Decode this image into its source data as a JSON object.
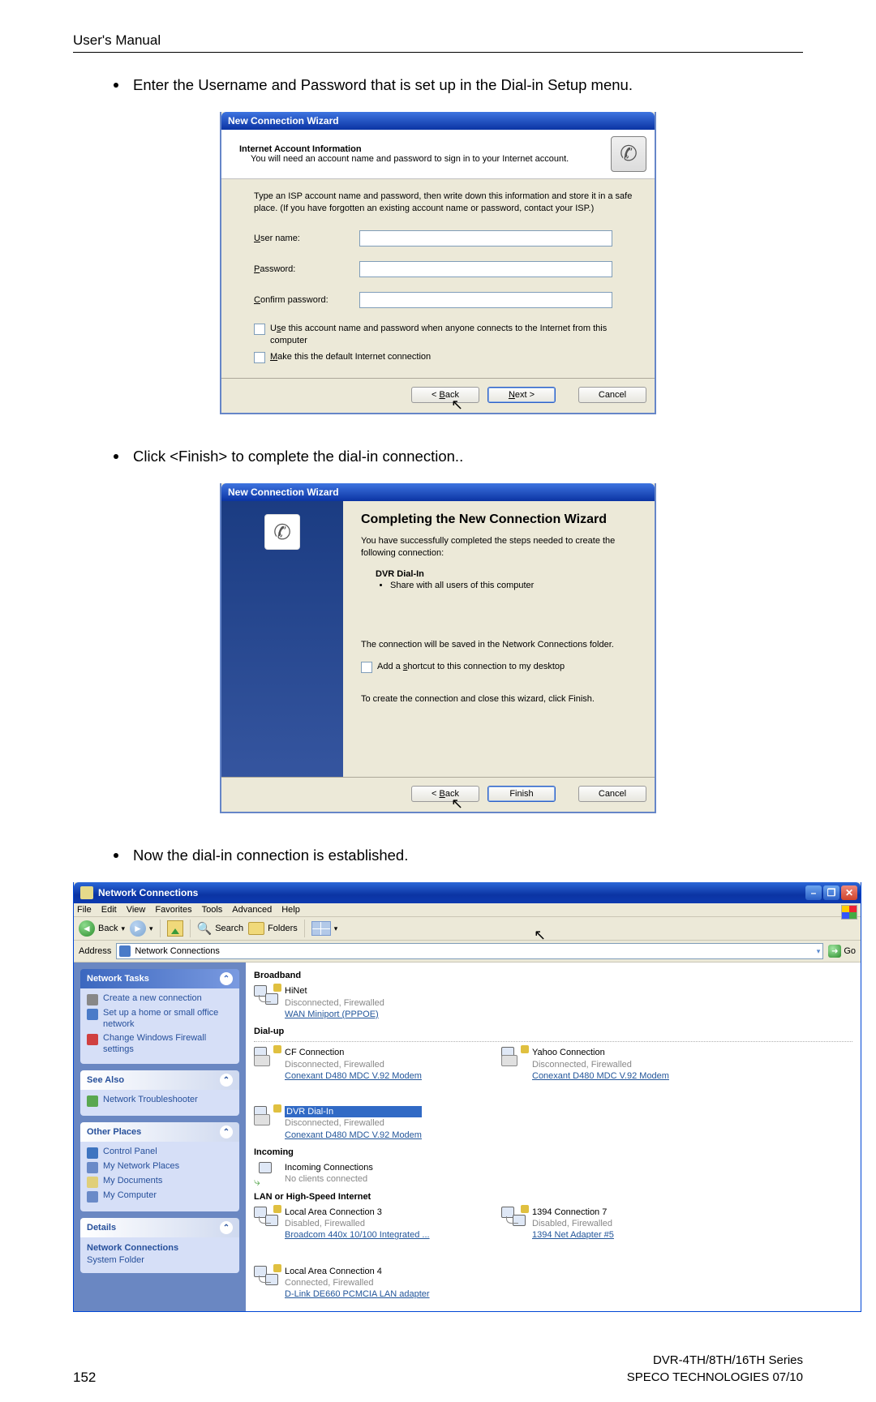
{
  "header": "User's Manual",
  "bullets": {
    "b1": "Enter the Username and Password that is set up in the Dial-in Setup menu.",
    "b2": "Click <Finish> to complete the dial-in connection..",
    "b3": "Now the dial-in connection is established."
  },
  "dlg1": {
    "title": "New Connection Wizard",
    "head_bold": "Internet Account Information",
    "head_sub": "You will need an account name and password to sign in to your Internet account.",
    "intro": "Type an ISP account name and password, then write down this information and store it in a safe place. (If you have forgotten an existing account name or password, contact your ISP.)",
    "lbl_user_pre": "U",
    "lbl_user_rest": "ser name:",
    "lbl_pass_pre": "P",
    "lbl_pass_rest": "assword:",
    "lbl_conf_pre": "C",
    "lbl_conf_rest": "onfirm password:",
    "cb1_pre": "U",
    "cb1_mid": "s",
    "cb1_rest": "e this account name and password when anyone connects to the Internet from this computer",
    "cb2_pre": "M",
    "cb2_rest": "ake this the default Internet connection",
    "back_pre": "< ",
    "back_u": "B",
    "back_rest": "ack",
    "next_u": "N",
    "next_rest": "ext >",
    "cancel": "Cancel"
  },
  "dlg2": {
    "title": "New Connection Wizard",
    "h": "Completing the New Connection Wizard",
    "suc": "You have successfully completed the steps needed to create the following connection:",
    "cname": "DVR Dial-In",
    "cshare": "Share with all users of this computer",
    "saved": "The connection will be saved in the Network Connections folder.",
    "cb_shortcut": "Add a shortcut to this connection to my desktop",
    "cb_shortcut_u": "s",
    "close": "To create the connection and close this wizard, click Finish.",
    "finish": "Finish"
  },
  "exp": {
    "title": "Network Connections",
    "menus": [
      "File",
      "Edit",
      "View",
      "Favorites",
      "Tools",
      "Advanced",
      "Help"
    ],
    "tb_back": "Back",
    "tb_search": "Search",
    "tb_folders": "Folders",
    "addr_label": "Address",
    "addr_value": "Network Connections",
    "go": "Go",
    "panel_tasks": "Network Tasks",
    "tasks": [
      "Create a new connection",
      "Set up a home or small office network",
      "Change Windows Firewall settings"
    ],
    "panel_see_also": "See Also",
    "see_also": [
      "Network Troubleshooter"
    ],
    "panel_other": "Other Places",
    "other": [
      "Control Panel",
      "My Network Places",
      "My Documents",
      "My Computer"
    ],
    "panel_details": "Details",
    "details_line1": "Network Connections",
    "details_line2": "System Folder",
    "cat_broadband": "Broadband",
    "bb": {
      "name": "HiNet",
      "status": "Disconnected, Firewalled",
      "device": "WAN Miniport (PPPOE)"
    },
    "cat_dialup": "Dial-up",
    "du": [
      {
        "name": "CF Connection",
        "status": "Disconnected, Firewalled",
        "device": "Conexant D480 MDC V.92 Modem"
      },
      {
        "name": "Yahoo Connection",
        "status": "Disconnected, Firewalled",
        "device": "Conexant D480 MDC V.92 Modem"
      },
      {
        "name": "DVR Dial-In",
        "status": "Disconnected, Firewalled",
        "device": "Conexant D480 MDC V.92 Modem"
      }
    ],
    "cat_incoming": "Incoming",
    "inc": {
      "name": "Incoming Connections",
      "status": "No clients connected"
    },
    "cat_lan": "LAN or High-Speed Internet",
    "lan": [
      {
        "name": "Local Area Connection 3",
        "status": "Disabled, Firewalled",
        "device": "Broadcom 440x 10/100 Integrated ..."
      },
      {
        "name": "1394 Connection 7",
        "status": "Disabled, Firewalled",
        "device": "1394 Net Adapter #5"
      },
      {
        "name": "Local Area Connection 4",
        "status": "Connected, Firewalled",
        "device": "D-Link DE660 PCMCIA LAN adapter"
      }
    ]
  },
  "footer": {
    "page": "152",
    "r1": "DVR-4TH/8TH/16TH Series",
    "r2": "SPECO TECHNOLOGIES 07/10"
  }
}
